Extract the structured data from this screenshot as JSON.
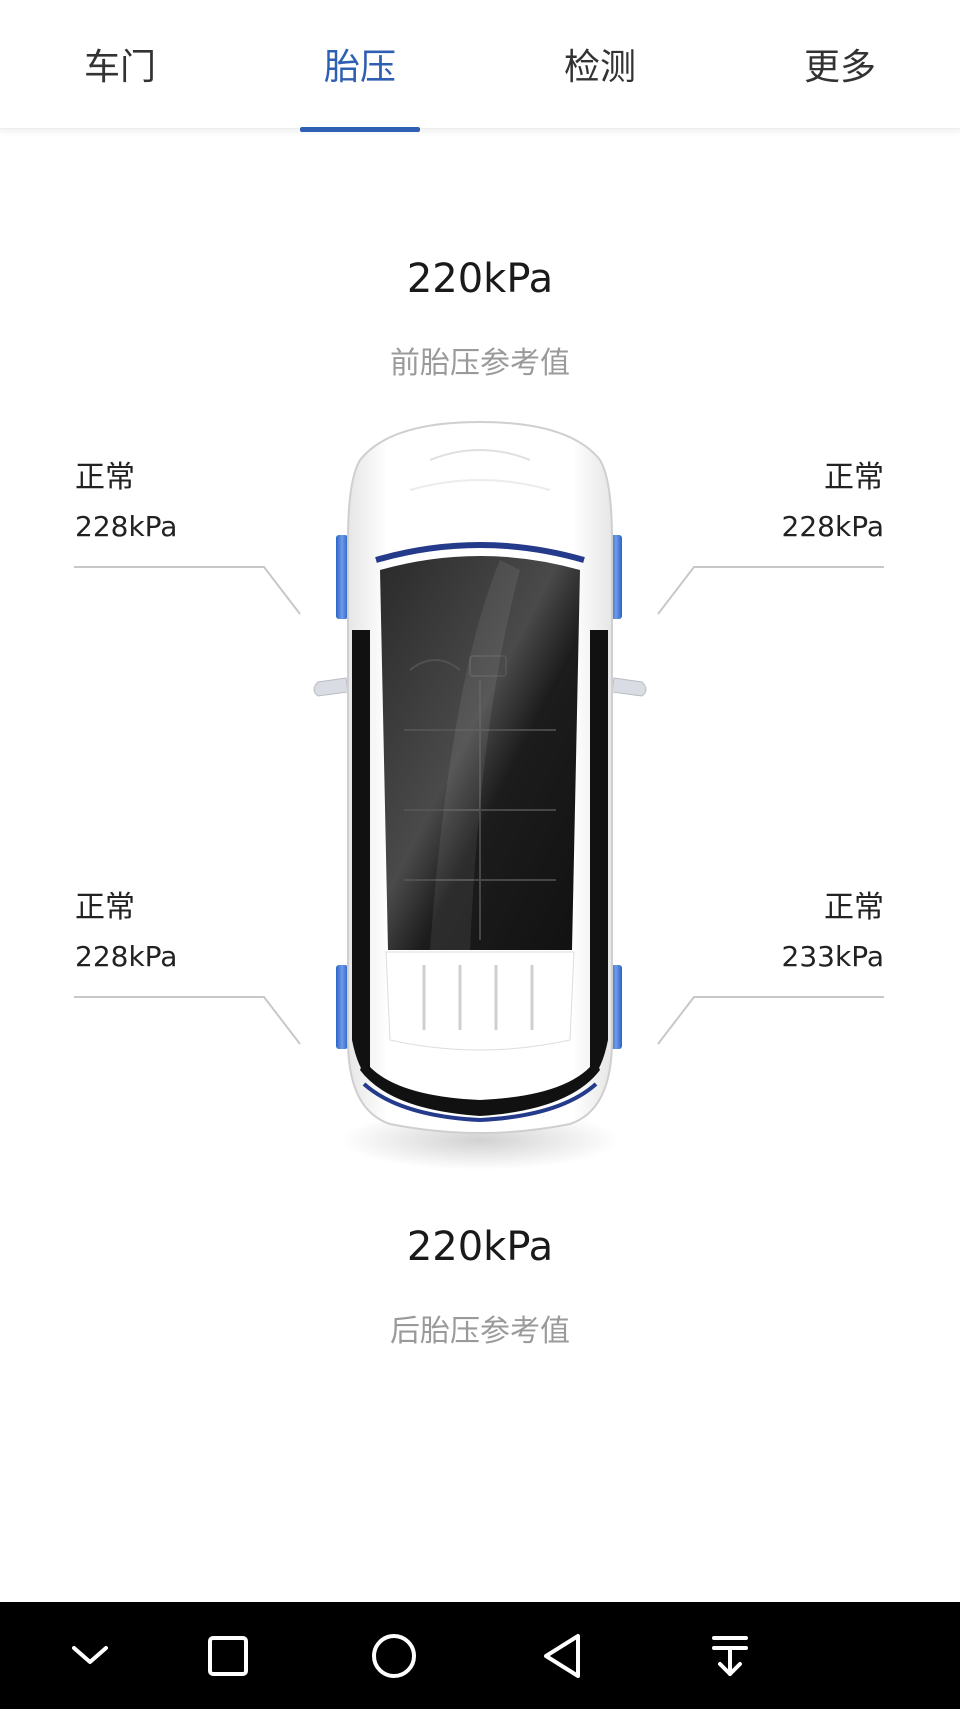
{
  "tabs": [
    {
      "label": "车门",
      "active": false
    },
    {
      "label": "胎压",
      "active": true
    },
    {
      "label": "检测",
      "active": false
    },
    {
      "label": "更多",
      "active": false
    }
  ],
  "front_reference": {
    "value": "220kPa",
    "label": "前胎压参考值"
  },
  "rear_reference": {
    "value": "220kPa",
    "label": "后胎压参考值"
  },
  "tires": {
    "front_left": {
      "status": "正常",
      "pressure": "228kPa"
    },
    "front_right": {
      "status": "正常",
      "pressure": "228kPa"
    },
    "rear_left": {
      "status": "正常",
      "pressure": "228kPa"
    },
    "rear_right": {
      "status": "正常",
      "pressure": "233kPa"
    }
  },
  "colors": {
    "accent": "#2f5fb3",
    "tire_highlight": "#3a6fd1",
    "muted_text": "#9a9a9a",
    "navbar": "#000000"
  },
  "navbar": {
    "icons": [
      "chevron-down-icon",
      "square-icon",
      "circle-home-icon",
      "back-triangle-icon",
      "pull-down-icon"
    ]
  }
}
